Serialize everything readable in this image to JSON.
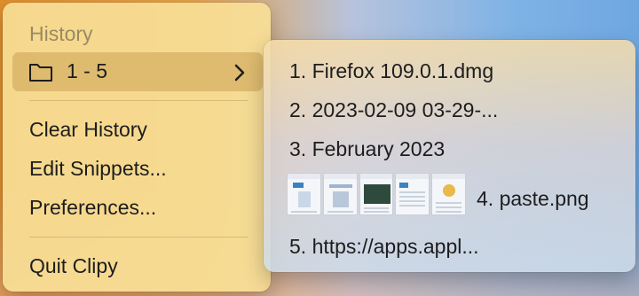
{
  "menu": {
    "section_title": "History",
    "selected_range": "1 - 5",
    "items": {
      "clear_history": "Clear History",
      "edit_snippets": "Edit Snippets...",
      "preferences": "Preferences...",
      "quit": "Quit Clipy"
    }
  },
  "submenu": {
    "items": [
      "1. Firefox 109.0.1.dmg",
      "2. 2023-02-09 03-29-...",
      "3. February 2023",
      "4. paste.png",
      "5. https://apps.appl..."
    ]
  },
  "icons": {
    "folder": "folder-icon",
    "chevron": "chevron-right-icon"
  }
}
